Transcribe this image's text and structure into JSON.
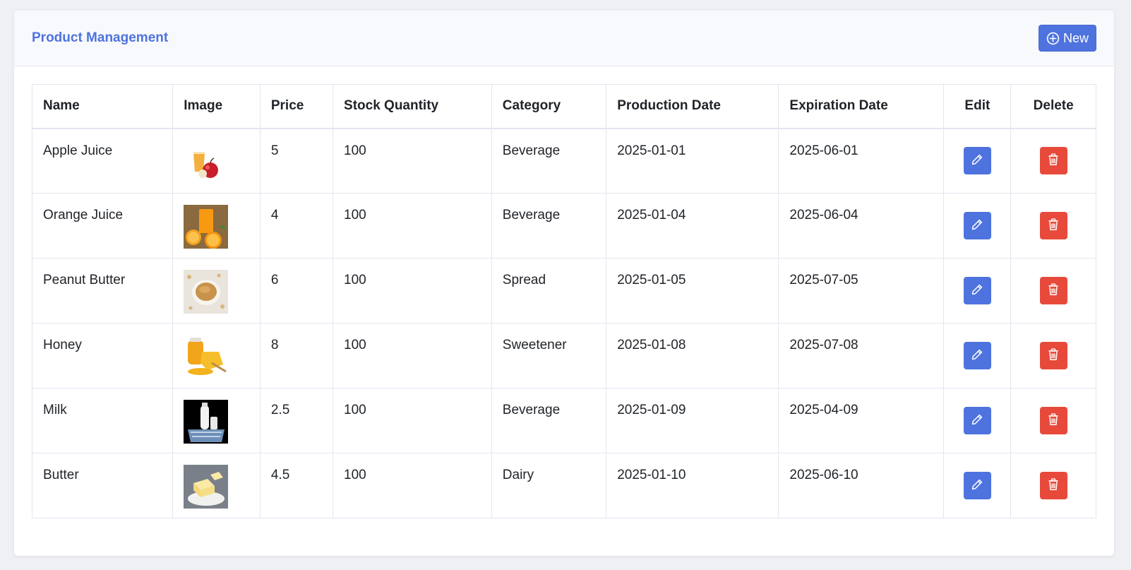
{
  "header": {
    "title": "Product Management",
    "new_label": "New"
  },
  "table": {
    "columns": [
      "Name",
      "Image",
      "Price",
      "Stock Quantity",
      "Category",
      "Production Date",
      "Expiration Date",
      "Edit",
      "Delete"
    ],
    "rows": [
      {
        "name": "Apple Juice",
        "image": "apple-juice-image",
        "price": "5",
        "stock": "100",
        "category": "Beverage",
        "production": "2025-01-01",
        "expiration": "2025-06-01"
      },
      {
        "name": "Orange Juice",
        "image": "orange-juice-image",
        "price": "4",
        "stock": "100",
        "category": "Beverage",
        "production": "2025-01-04",
        "expiration": "2025-06-04"
      },
      {
        "name": "Peanut Butter",
        "image": "peanut-butter-image",
        "price": "6",
        "stock": "100",
        "category": "Spread",
        "production": "2025-01-05",
        "expiration": "2025-07-05"
      },
      {
        "name": "Honey",
        "image": "honey-image",
        "price": "8",
        "stock": "100",
        "category": "Sweetener",
        "production": "2025-01-08",
        "expiration": "2025-07-08"
      },
      {
        "name": "Milk",
        "image": "milk-image",
        "price": "2.5",
        "stock": "100",
        "category": "Beverage",
        "production": "2025-01-09",
        "expiration": "2025-04-09"
      },
      {
        "name": "Butter",
        "image": "butter-image",
        "price": "4.5",
        "stock": "100",
        "category": "Dairy",
        "production": "2025-01-10",
        "expiration": "2025-06-10"
      }
    ]
  },
  "colors": {
    "primary": "#4e73df",
    "danger": "#e74a3b",
    "header_bg": "#f8f9fc",
    "page_bg": "#eff0f4"
  },
  "icons": {
    "new": "plus-circle-icon",
    "edit": "pencil-icon",
    "delete": "trash-icon"
  }
}
